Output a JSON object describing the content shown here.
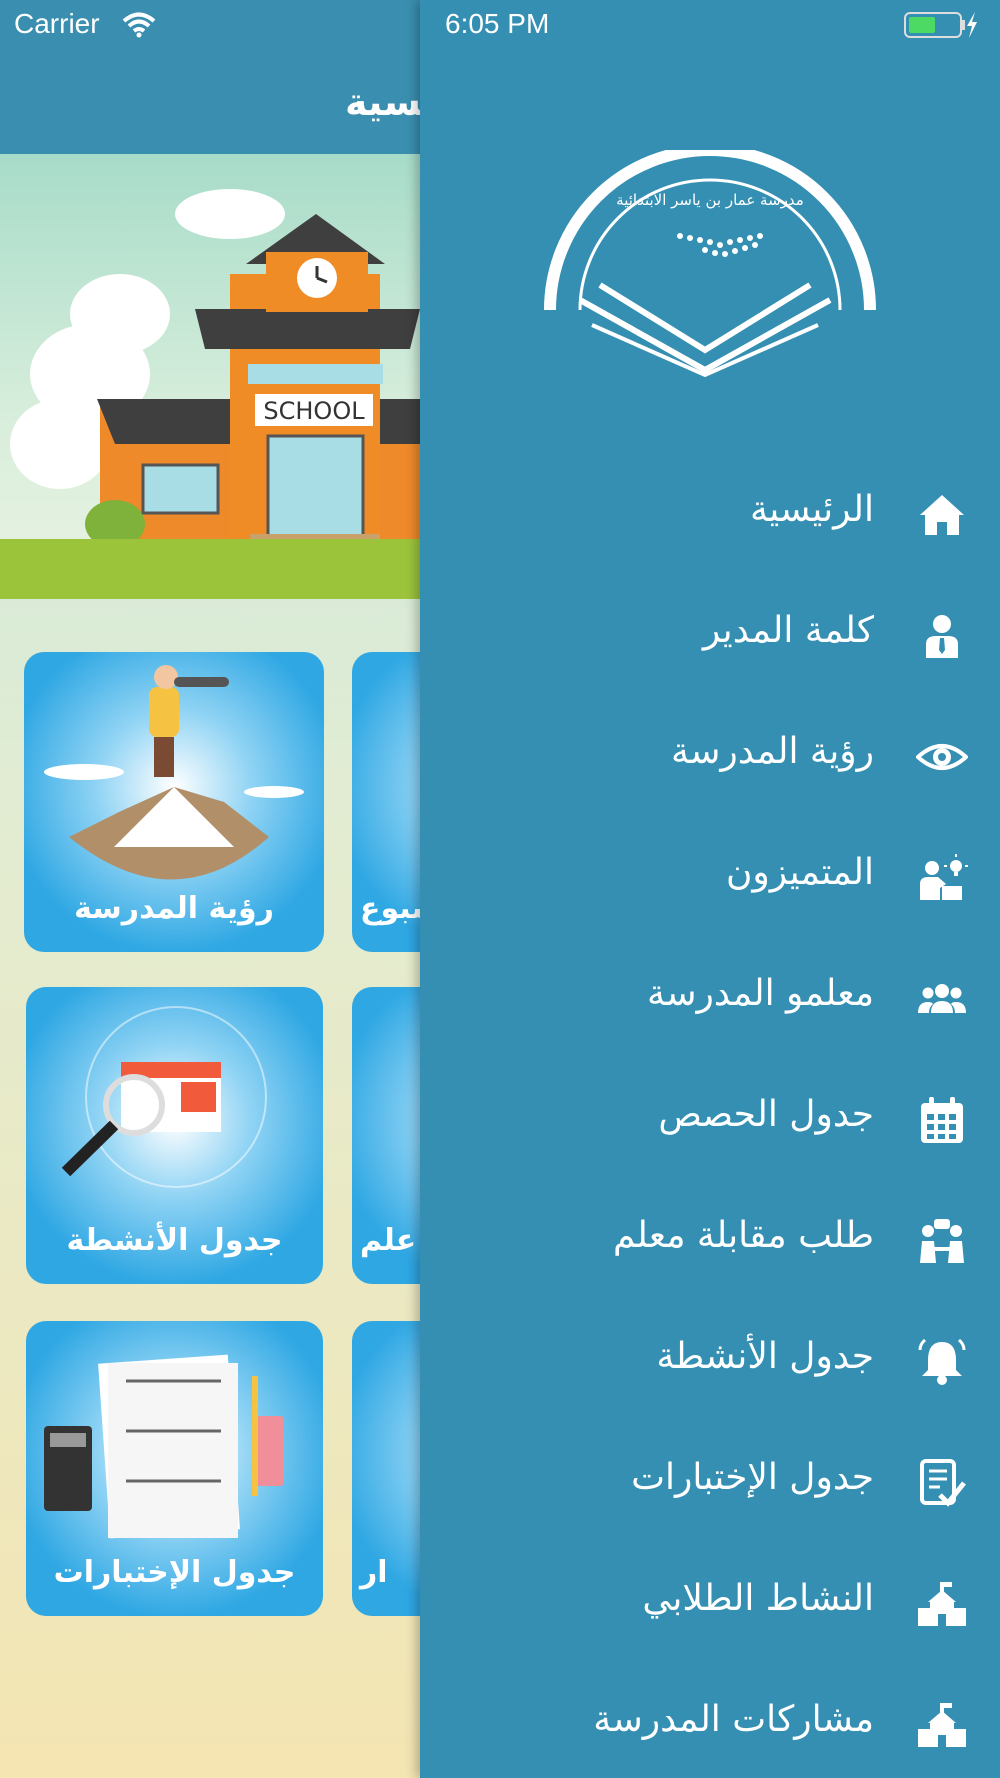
{
  "status_bar": {
    "carrier": "Carrier",
    "time": "6:05 PM"
  },
  "main": {
    "title": "الرئيسية",
    "tiles": [
      {
        "label": "رؤية المدرسة"
      },
      {
        "label": "سبوع"
      },
      {
        "label": "جدول الأنشطة"
      },
      {
        "label": "علم"
      },
      {
        "label": "جدول الإختبارات"
      },
      {
        "label": "ار"
      }
    ],
    "school_sign": "SCHOOL"
  },
  "drawer": {
    "logo_text": "مدرسة عمار بن ياسر الابتدائية",
    "items": [
      {
        "label": "الرئيسية",
        "icon": "home-icon"
      },
      {
        "label": "كلمة المدير",
        "icon": "user-tie-icon"
      },
      {
        "label": "رؤية المدرسة",
        "icon": "eye-icon"
      },
      {
        "label": "المتميزون",
        "icon": "teacher-idea-icon"
      },
      {
        "label": "معلمو المدرسة",
        "icon": "users-icon"
      },
      {
        "label": "جدول الحصص",
        "icon": "calendar-icon"
      },
      {
        "label": "طلب مقابلة معلم",
        "icon": "meeting-icon"
      },
      {
        "label": "جدول الأنشطة",
        "icon": "bell-icon"
      },
      {
        "label": "جدول الإختبارات",
        "icon": "checklist-icon"
      },
      {
        "label": "النشاط الطلابي",
        "icon": "school-icon"
      },
      {
        "label": "مشاركات المدرسة",
        "icon": "school-building-icon"
      }
    ]
  },
  "colors": {
    "drawer": "#348fb2",
    "topbar": "#3a8fb0",
    "tile": "#2ea7e3"
  }
}
